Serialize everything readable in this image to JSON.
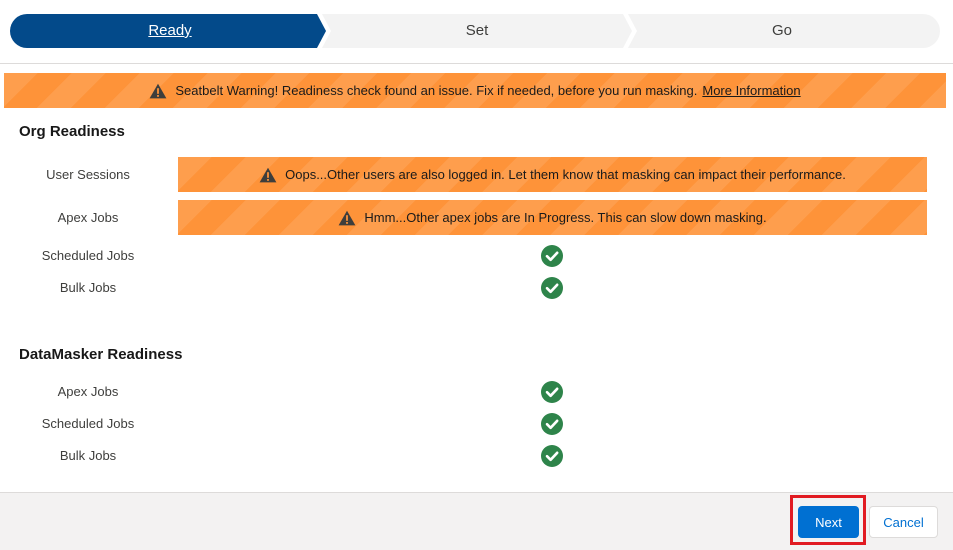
{
  "path": {
    "stages": [
      {
        "label": "Ready",
        "active": true
      },
      {
        "label": "Set",
        "active": false
      },
      {
        "label": "Go",
        "active": false
      }
    ]
  },
  "seatbelt": {
    "message": "Seatbelt Warning! Readiness check found an issue. Fix if needed, before you run masking.",
    "link_label": "More Information",
    "icon": "warning-icon"
  },
  "org_readiness": {
    "title": "Org Readiness",
    "rows": [
      {
        "label": "User Sessions",
        "status": "warning",
        "message": "Oops...Other users are also logged in. Let them know that masking can impact their performance."
      },
      {
        "label": "Apex Jobs",
        "status": "warning",
        "message": "Hmm...Other apex jobs are In Progress. This can slow down masking."
      },
      {
        "label": "Scheduled Jobs",
        "status": "ok"
      },
      {
        "label": "Bulk Jobs",
        "status": "ok"
      }
    ]
  },
  "datamasker_readiness": {
    "title": "DataMasker Readiness",
    "rows": [
      {
        "label": "Apex Jobs",
        "status": "ok"
      },
      {
        "label": "Scheduled Jobs",
        "status": "ok"
      },
      {
        "label": "Bulk Jobs",
        "status": "ok"
      }
    ]
  },
  "footer": {
    "next_label": "Next",
    "cancel_label": "Cancel"
  },
  "colors": {
    "active_stage": "#034a8a",
    "inactive_stage": "#f3f3f3",
    "warning": "#fe9339",
    "success": "#2e844a",
    "brand": "#0070d2",
    "highlight": "#e11b22"
  }
}
